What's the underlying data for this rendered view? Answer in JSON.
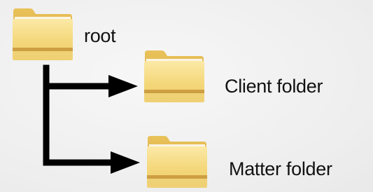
{
  "tree": {
    "root": {
      "label": "root",
      "icon": "folder-icon"
    },
    "children": [
      {
        "label": "Client folder",
        "icon": "folder-icon"
      },
      {
        "label": "Matter folder",
        "icon": "folder-icon"
      }
    ]
  },
  "colors": {
    "background": "#eeeeee",
    "folder_body": "#f3d77a",
    "folder_back": "#e2b64a",
    "folder_stripe": "#c7953a",
    "connector": "#000000",
    "text": "#111111"
  }
}
